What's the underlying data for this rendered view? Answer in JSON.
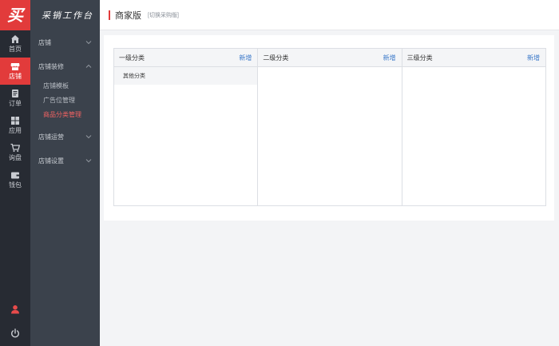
{
  "logo": {
    "glyph": "买"
  },
  "rail": {
    "items": [
      {
        "label": "首页",
        "icon": "home-icon"
      },
      {
        "label": "店铺",
        "icon": "store-icon"
      },
      {
        "label": "订单",
        "icon": "order-icon"
      },
      {
        "label": "应用",
        "icon": "apps-icon"
      },
      {
        "label": "询盘",
        "icon": "cart-icon"
      },
      {
        "label": "钱包",
        "icon": "wallet-icon"
      }
    ],
    "active_index": 1,
    "bottom": [
      {
        "icon": "user-icon"
      },
      {
        "icon": "power-icon"
      }
    ]
  },
  "menu": {
    "title": "采销工作台",
    "groups": [
      {
        "label": "店铺"
      },
      {
        "label": "店铺装修"
      },
      {
        "label": "店铺运营"
      },
      {
        "label": "店铺设置"
      }
    ],
    "sub": [
      {
        "label": "店铺模板"
      },
      {
        "label": "广告位管理"
      },
      {
        "label": "商品分类管理"
      }
    ]
  },
  "header": {
    "title": "商家版",
    "switch_label": "[切换采购版]"
  },
  "panels": [
    {
      "title": "一级分类",
      "add_label": "新增",
      "rows": [
        "其他分类"
      ]
    },
    {
      "title": "二级分类",
      "add_label": "新增",
      "rows": []
    },
    {
      "title": "三级分类",
      "add_label": "新增",
      "rows": []
    }
  ],
  "colors": {
    "brand": "#e23b3b",
    "rail_bg": "#272b33",
    "menu_bg": "#3b424c",
    "link": "#3a78c9",
    "active_sub": "#f06262"
  }
}
